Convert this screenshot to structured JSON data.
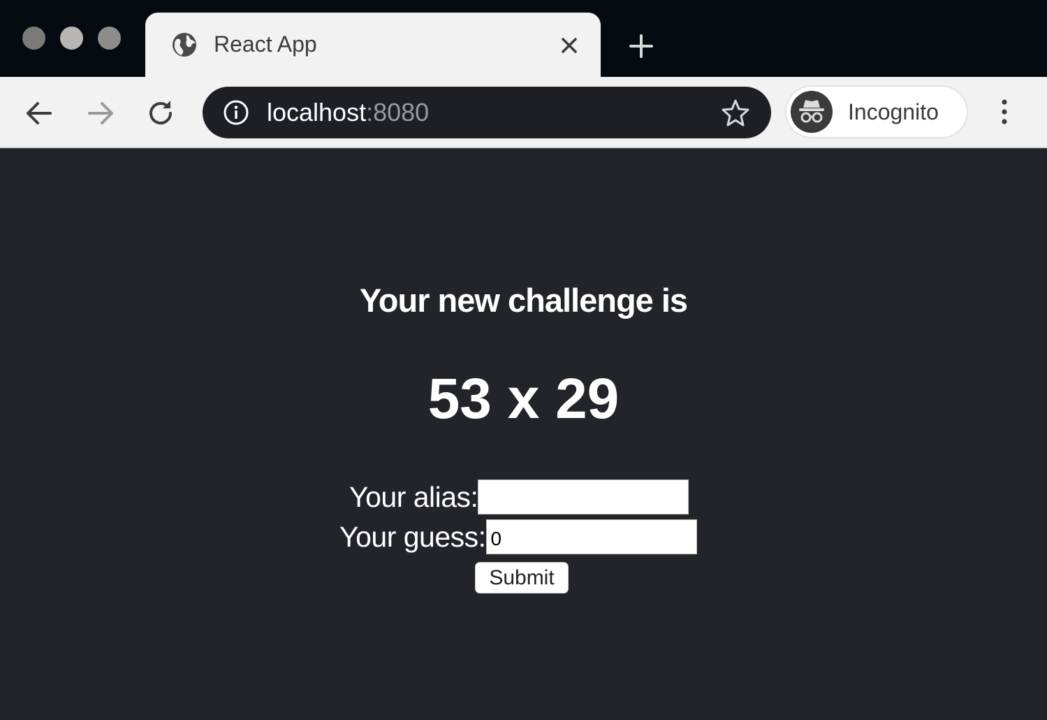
{
  "browser": {
    "tab": {
      "title": "React App",
      "favicon": "globe-icon",
      "close_icon": "close-icon"
    },
    "new_tab_icon": "plus-icon",
    "toolbar": {
      "back_icon": "back-arrow-icon",
      "forward_icon": "forward-arrow-icon",
      "reload_icon": "reload-icon",
      "address": {
        "host": "localhost",
        "port": ":8080",
        "info_icon": "info-icon",
        "bookmark_icon": "star-icon"
      },
      "profile": {
        "label": "Incognito",
        "icon": "incognito-icon"
      },
      "menu_icon": "more-vertical-icon"
    }
  },
  "page": {
    "heading": "Your new challenge is",
    "challenge": "53 x 29",
    "form": {
      "alias_label": "Your alias:",
      "alias_value": "",
      "guess_label": "Your guess:",
      "guess_value": "0",
      "submit_label": "Submit"
    }
  },
  "colors": {
    "page_background": "#232429",
    "tabstrip_background": "#060b12",
    "toolbar_background": "#f2f2f2",
    "omnibox_background": "#1e1f24"
  }
}
